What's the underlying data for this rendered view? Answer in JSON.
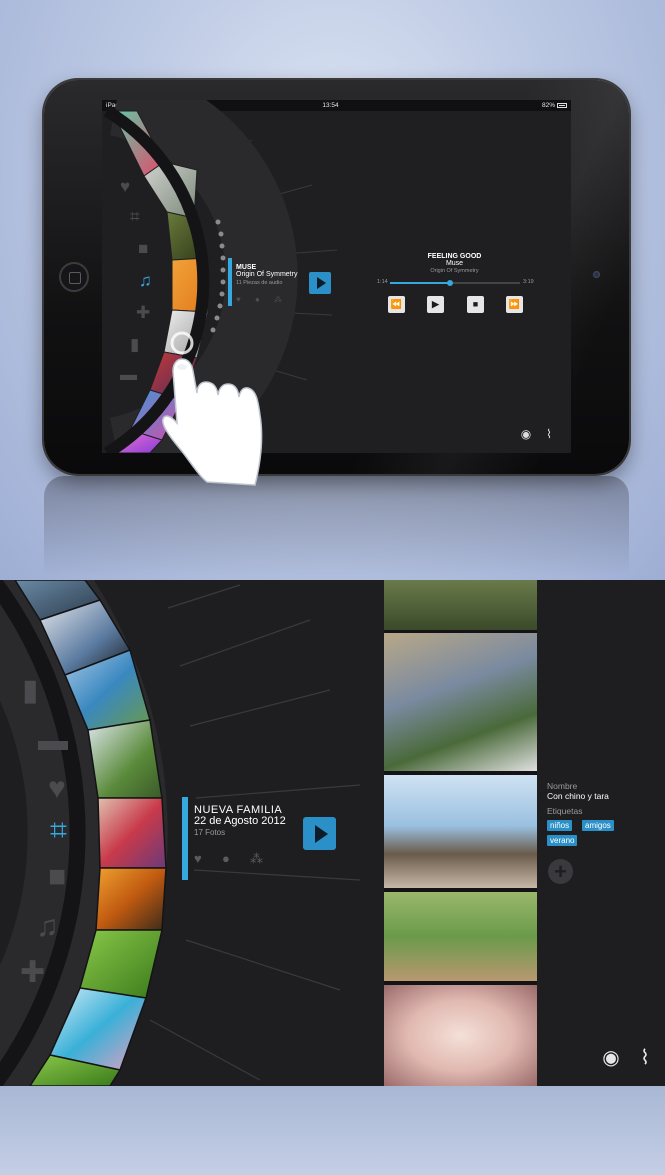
{
  "colors": {
    "accent": "#35a8e0",
    "play_bg": "#2b90c8",
    "panel": "#1e1e21"
  },
  "status_bar": {
    "device": "iPad",
    "time": "13:54",
    "battery": "82%"
  },
  "sidebar_icons": [
    "heart-icon",
    "photo-frame-icon",
    "video-camera-icon",
    "music-note-icon",
    "gamepad-icon",
    "book-icon",
    "folder-icon"
  ],
  "music_album": {
    "artist": "MUSE",
    "title": "Origin Of Symmetry",
    "count": "11 Piezas de audio"
  },
  "player": {
    "song": "FEELING GOOD",
    "artist": "Muse",
    "album": "Origin Of Symmetry",
    "elapsed": "1:14",
    "total": "3:19",
    "progress": 0.46,
    "buttons": {
      "rewind": "⏪",
      "play": "▶",
      "stop": "■",
      "forward": "⏩"
    }
  },
  "photo_album": {
    "title": "NUEVA FAMILIA",
    "date": "22 de Agosto 2012",
    "count": "17 Fotos"
  },
  "photo_meta": {
    "name_label": "Nombre",
    "name_value": "Con chino y tara",
    "tags_label": "Etiquetas",
    "tags": [
      "niños",
      "amigos",
      "verano"
    ]
  }
}
